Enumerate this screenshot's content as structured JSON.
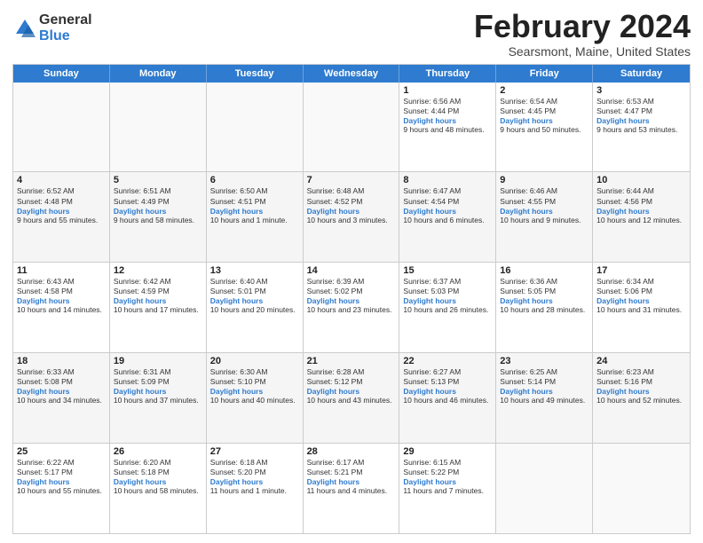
{
  "logo": {
    "general": "General",
    "blue": "Blue"
  },
  "title": "February 2024",
  "subtitle": "Searsmont, Maine, United States",
  "weekdays": [
    "Sunday",
    "Monday",
    "Tuesday",
    "Wednesday",
    "Thursday",
    "Friday",
    "Saturday"
  ],
  "rows": [
    [
      {
        "day": "",
        "info": "",
        "empty": true
      },
      {
        "day": "",
        "info": "",
        "empty": true
      },
      {
        "day": "",
        "info": "",
        "empty": true
      },
      {
        "day": "",
        "info": "",
        "empty": true
      },
      {
        "day": "1",
        "sunrise": "Sunrise: 6:56 AM",
        "sunset": "Sunset: 4:44 PM",
        "daylight": "Daylight: 9 hours and 48 minutes."
      },
      {
        "day": "2",
        "sunrise": "Sunrise: 6:54 AM",
        "sunset": "Sunset: 4:45 PM",
        "daylight": "Daylight: 9 hours and 50 minutes."
      },
      {
        "day": "3",
        "sunrise": "Sunrise: 6:53 AM",
        "sunset": "Sunset: 4:47 PM",
        "daylight": "Daylight: 9 hours and 53 minutes."
      }
    ],
    [
      {
        "day": "4",
        "sunrise": "Sunrise: 6:52 AM",
        "sunset": "Sunset: 4:48 PM",
        "daylight": "Daylight: 9 hours and 55 minutes."
      },
      {
        "day": "5",
        "sunrise": "Sunrise: 6:51 AM",
        "sunset": "Sunset: 4:49 PM",
        "daylight": "Daylight: 9 hours and 58 minutes."
      },
      {
        "day": "6",
        "sunrise": "Sunrise: 6:50 AM",
        "sunset": "Sunset: 4:51 PM",
        "daylight": "Daylight: 10 hours and 1 minute."
      },
      {
        "day": "7",
        "sunrise": "Sunrise: 6:48 AM",
        "sunset": "Sunset: 4:52 PM",
        "daylight": "Daylight: 10 hours and 3 minutes."
      },
      {
        "day": "8",
        "sunrise": "Sunrise: 6:47 AM",
        "sunset": "Sunset: 4:54 PM",
        "daylight": "Daylight: 10 hours and 6 minutes."
      },
      {
        "day": "9",
        "sunrise": "Sunrise: 6:46 AM",
        "sunset": "Sunset: 4:55 PM",
        "daylight": "Daylight: 10 hours and 9 minutes."
      },
      {
        "day": "10",
        "sunrise": "Sunrise: 6:44 AM",
        "sunset": "Sunset: 4:56 PM",
        "daylight": "Daylight: 10 hours and 12 minutes."
      }
    ],
    [
      {
        "day": "11",
        "sunrise": "Sunrise: 6:43 AM",
        "sunset": "Sunset: 4:58 PM",
        "daylight": "Daylight: 10 hours and 14 minutes."
      },
      {
        "day": "12",
        "sunrise": "Sunrise: 6:42 AM",
        "sunset": "Sunset: 4:59 PM",
        "daylight": "Daylight: 10 hours and 17 minutes."
      },
      {
        "day": "13",
        "sunrise": "Sunrise: 6:40 AM",
        "sunset": "Sunset: 5:01 PM",
        "daylight": "Daylight: 10 hours and 20 minutes."
      },
      {
        "day": "14",
        "sunrise": "Sunrise: 6:39 AM",
        "sunset": "Sunset: 5:02 PM",
        "daylight": "Daylight: 10 hours and 23 minutes."
      },
      {
        "day": "15",
        "sunrise": "Sunrise: 6:37 AM",
        "sunset": "Sunset: 5:03 PM",
        "daylight": "Daylight: 10 hours and 26 minutes."
      },
      {
        "day": "16",
        "sunrise": "Sunrise: 6:36 AM",
        "sunset": "Sunset: 5:05 PM",
        "daylight": "Daylight: 10 hours and 28 minutes."
      },
      {
        "day": "17",
        "sunrise": "Sunrise: 6:34 AM",
        "sunset": "Sunset: 5:06 PM",
        "daylight": "Daylight: 10 hours and 31 minutes."
      }
    ],
    [
      {
        "day": "18",
        "sunrise": "Sunrise: 6:33 AM",
        "sunset": "Sunset: 5:08 PM",
        "daylight": "Daylight: 10 hours and 34 minutes."
      },
      {
        "day": "19",
        "sunrise": "Sunrise: 6:31 AM",
        "sunset": "Sunset: 5:09 PM",
        "daylight": "Daylight: 10 hours and 37 minutes."
      },
      {
        "day": "20",
        "sunrise": "Sunrise: 6:30 AM",
        "sunset": "Sunset: 5:10 PM",
        "daylight": "Daylight: 10 hours and 40 minutes."
      },
      {
        "day": "21",
        "sunrise": "Sunrise: 6:28 AM",
        "sunset": "Sunset: 5:12 PM",
        "daylight": "Daylight: 10 hours and 43 minutes."
      },
      {
        "day": "22",
        "sunrise": "Sunrise: 6:27 AM",
        "sunset": "Sunset: 5:13 PM",
        "daylight": "Daylight: 10 hours and 46 minutes."
      },
      {
        "day": "23",
        "sunrise": "Sunrise: 6:25 AM",
        "sunset": "Sunset: 5:14 PM",
        "daylight": "Daylight: 10 hours and 49 minutes."
      },
      {
        "day": "24",
        "sunrise": "Sunrise: 6:23 AM",
        "sunset": "Sunset: 5:16 PM",
        "daylight": "Daylight: 10 hours and 52 minutes."
      }
    ],
    [
      {
        "day": "25",
        "sunrise": "Sunrise: 6:22 AM",
        "sunset": "Sunset: 5:17 PM",
        "daylight": "Daylight: 10 hours and 55 minutes."
      },
      {
        "day": "26",
        "sunrise": "Sunrise: 6:20 AM",
        "sunset": "Sunset: 5:18 PM",
        "daylight": "Daylight: 10 hours and 58 minutes."
      },
      {
        "day": "27",
        "sunrise": "Sunrise: 6:18 AM",
        "sunset": "Sunset: 5:20 PM",
        "daylight": "Daylight: 11 hours and 1 minute."
      },
      {
        "day": "28",
        "sunrise": "Sunrise: 6:17 AM",
        "sunset": "Sunset: 5:21 PM",
        "daylight": "Daylight: 11 hours and 4 minutes."
      },
      {
        "day": "29",
        "sunrise": "Sunrise: 6:15 AM",
        "sunset": "Sunset: 5:22 PM",
        "daylight": "Daylight: 11 hours and 7 minutes."
      },
      {
        "day": "",
        "info": "",
        "empty": true
      },
      {
        "day": "",
        "info": "",
        "empty": true
      }
    ]
  ]
}
